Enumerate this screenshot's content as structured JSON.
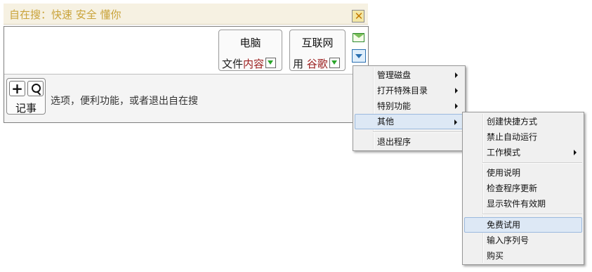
{
  "window": {
    "title": "自在搜：快速 安全 懂你",
    "close_icon": "close-x-icon"
  },
  "search_sources": {
    "pc": {
      "title": "电脑",
      "prefix": "文件",
      "selected": "内容"
    },
    "web": {
      "title": "互联网",
      "prefix": "用 ",
      "selected": "谷歌"
    }
  },
  "side_icons": {
    "mail": "mail-icon",
    "menu": "menu-dropdown-icon"
  },
  "note_button": {
    "label": "记事",
    "plus": "+"
  },
  "hint_text": "选项，便利功能，或者退出自在搜",
  "main_menu": {
    "items": [
      {
        "label": "管理磁盘",
        "submenu": true
      },
      {
        "label": "打开特殊目录",
        "submenu": true
      },
      {
        "label": "特别功能",
        "submenu": true
      },
      {
        "label": "其他",
        "submenu": true,
        "highlighted": true
      },
      {
        "label": "退出程序",
        "submenu": false
      }
    ]
  },
  "submenu_other": {
    "items": [
      {
        "label": "创建快捷方式",
        "submenu": false
      },
      {
        "label": "禁止自动运行",
        "submenu": false
      },
      {
        "label": "工作模式",
        "submenu": true
      },
      {
        "label": "使用说明",
        "submenu": false
      },
      {
        "label": "检查程序更新",
        "submenu": false
      },
      {
        "label": "显示软件有效期",
        "submenu": false
      },
      {
        "label": "免费试用",
        "submenu": false,
        "highlighted": true
      },
      {
        "label": "输入序列号",
        "submenu": false
      },
      {
        "label": "购买",
        "submenu": false
      }
    ]
  },
  "colors": {
    "title_text": "#c9a33a",
    "title_bg": "#f6f1e2",
    "selected_text": "#9b1d1d",
    "dropdown_arrow": "#2aa52a",
    "menu_highlight": "#dde8f5"
  }
}
